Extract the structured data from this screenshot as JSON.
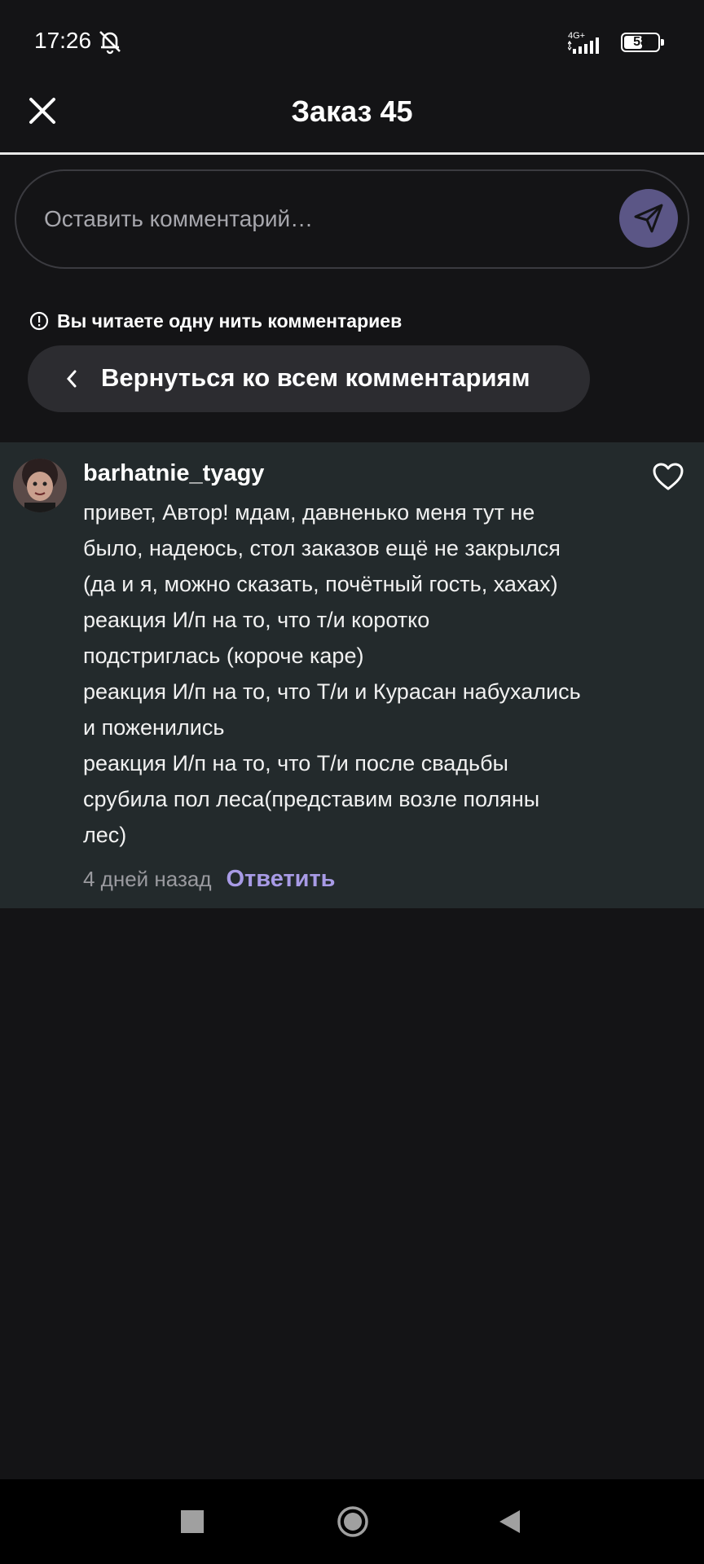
{
  "status_bar": {
    "time": "17:26",
    "network": "4G+",
    "battery": "58",
    "battery_level": 0.58
  },
  "header": {
    "title": "Заказ 45"
  },
  "comment_input": {
    "placeholder": "Оставить комментарий…"
  },
  "thread": {
    "notice": "Вы читаете одну нить комментариев",
    "back_label": "Вернуться ко всем комментариям"
  },
  "comment": {
    "username": "barhatnie_tyagy",
    "lines": [
      "привет, Автор! мдам, давненько меня тут не",
      "было, надеюсь, стол заказов ещё не закрылся",
      "(да и я, можно сказать, почётный гость, хахах)",
      "реакция И/п на то, что т/и коротко",
      "подстриглась (короче каре)",
      "реакция И/п на то, что Т/и и Курасан набухались",
      "и поженились",
      "реакция И/п на то, что Т/и после свадьбы",
      "срубила пол леса(представим возле поляны",
      "лес)"
    ],
    "time": "4 дней назад",
    "reply_label": "Ответить"
  },
  "colors": {
    "background": "#141416",
    "card": "#232a2c",
    "accent": "#a89be6",
    "send_button": "#5b5686"
  }
}
